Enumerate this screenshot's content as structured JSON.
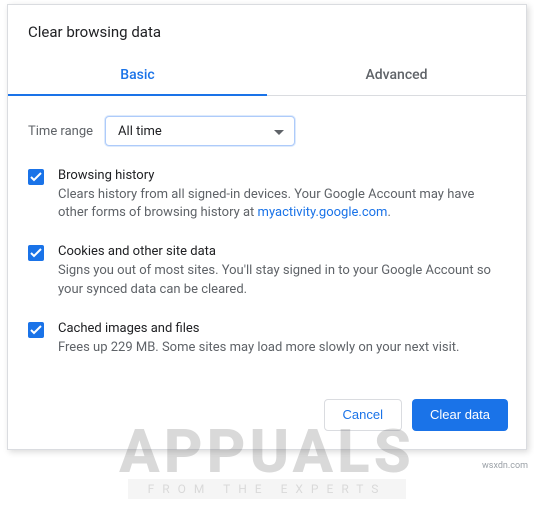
{
  "dialog": {
    "title": "Clear browsing data",
    "tabs": {
      "basic": "Basic",
      "advanced": "Advanced"
    },
    "time": {
      "label": "Time range",
      "selected": "All time"
    },
    "items": [
      {
        "title": "Browsing history",
        "desc_a": "Clears history from all signed-in devices. Your Google Account may have other forms of browsing history at ",
        "link": "myactivity.google.com",
        "desc_b": "."
      },
      {
        "title": "Cookies and other site data",
        "desc_a": "Signs you out of most sites. You'll stay signed in to your Google Account so your synced data can be cleared."
      },
      {
        "title": "Cached images and files",
        "desc_a": "Frees up 229 MB. Some sites may load more slowly on your next visit."
      }
    ],
    "buttons": {
      "cancel": "Cancel",
      "confirm": "Clear data"
    }
  },
  "watermark": {
    "big": "APPUALS",
    "small": "FROM THE EXPERTS",
    "attrib": "wsxdn.com"
  }
}
